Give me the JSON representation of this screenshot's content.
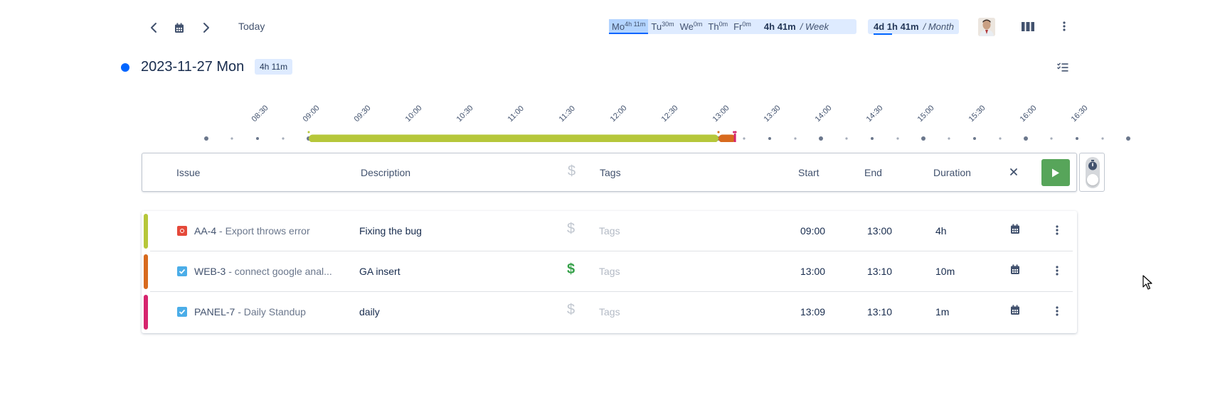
{
  "toolbar": {
    "today_label": "Today",
    "days": [
      {
        "label": "Mo",
        "time": "4h 11m",
        "active": true
      },
      {
        "label": "Tu",
        "time": "30m",
        "active": false
      },
      {
        "label": "We",
        "time": "0m",
        "active": false
      },
      {
        "label": "Th",
        "time": "0m",
        "active": false
      },
      {
        "label": "Fr",
        "time": "0m",
        "active": false
      }
    ],
    "week_total": "4h 41m",
    "week_label": "/ Week",
    "month_total": "4d 1h 41m",
    "month_label": "/ Month"
  },
  "date_header": {
    "title": "2023-11-27 Mon",
    "badge": "4h 11m",
    "dot_color": "#0065ff"
  },
  "timeline": {
    "ticks": [
      "08:30",
      "09:00",
      "09:30",
      "10:00",
      "10:30",
      "11:00",
      "11:30",
      "12:00",
      "12:30",
      "13:00",
      "13:30",
      "14:00",
      "14:30",
      "15:00",
      "15:30",
      "16:00",
      "16:30"
    ],
    "blocks": [
      {
        "start": "09:00",
        "end": "13:00",
        "color": "#b6c73a"
      },
      {
        "start": "13:00",
        "end": "13:10",
        "color": "#d86a1e"
      },
      {
        "start": "13:09",
        "end": "13:10",
        "color": "#d6246e"
      }
    ]
  },
  "entry_header": {
    "issue": "Issue",
    "description": "Description",
    "tags": "Tags",
    "start": "Start",
    "end": "End",
    "duration": "Duration"
  },
  "worklogs": [
    {
      "key": "AA-4",
      "summary": " - Export throws error",
      "description": "Fixing the bug",
      "billable": false,
      "tags_placeholder": "Tags",
      "start": "09:00",
      "end": "13:00",
      "duration": "4h",
      "color": "#b6c73a",
      "type": "bug-icon",
      "type_color": "#e5493a"
    },
    {
      "key": "WEB-3",
      "summary": " - connect google anal...",
      "description": "GA insert",
      "billable": true,
      "tags_placeholder": "Tags",
      "start": "13:00",
      "end": "13:10",
      "duration": "10m",
      "color": "#d86a1e",
      "type": "task-checkbox-icon",
      "type_color": "#4bade8"
    },
    {
      "key": "PANEL-7",
      "summary": " - Daily Standup",
      "description": "daily",
      "billable": false,
      "tags_placeholder": "Tags",
      "start": "13:09",
      "end": "13:10",
      "duration": "1m",
      "color": "#d6246e",
      "type": "task-checkbox-icon",
      "type_color": "#4bade8"
    }
  ]
}
